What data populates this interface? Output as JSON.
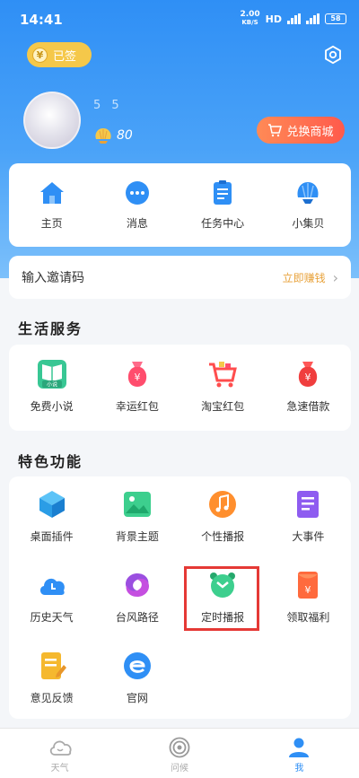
{
  "status_bar": {
    "time": "14:41",
    "net_speed_value": "2.00",
    "net_speed_unit": "KB/S",
    "hd": "HD",
    "battery": "58"
  },
  "header": {
    "signin_label": "已签",
    "coin_symbol": "¥",
    "username": "5 5",
    "shell_count": "80",
    "mall_label": "兑换商城"
  },
  "nav": [
    {
      "label": "主页",
      "icon": "home-icon"
    },
    {
      "label": "消息",
      "icon": "message-icon"
    },
    {
      "label": "任务中心",
      "icon": "task-icon"
    },
    {
      "label": "小集贝",
      "icon": "shell-icon"
    }
  ],
  "invite": {
    "label": "输入邀请码",
    "link": "立即赚钱"
  },
  "life": {
    "title": "生活服务",
    "items": [
      {
        "label": "免费小说",
        "icon": "book-icon",
        "badge": "小说"
      },
      {
        "label": "幸运红包",
        "icon": "lucky-bag-icon"
      },
      {
        "label": "淘宝红包",
        "icon": "shopping-cart-icon"
      },
      {
        "label": "急速借款",
        "icon": "money-bag-icon"
      }
    ]
  },
  "features": {
    "title": "特色功能",
    "items": [
      {
        "label": "桌面插件",
        "icon": "cube-icon"
      },
      {
        "label": "背景主题",
        "icon": "image-icon"
      },
      {
        "label": "个性播报",
        "icon": "music-icon"
      },
      {
        "label": "大事件",
        "icon": "document-icon"
      },
      {
        "label": "历史天气",
        "icon": "cloud-clock-icon"
      },
      {
        "label": "台风路径",
        "icon": "typhoon-icon"
      },
      {
        "label": "定时播报",
        "icon": "alarm-clock-icon"
      },
      {
        "label": "领取福利",
        "icon": "red-envelope-icon"
      },
      {
        "label": "意见反馈",
        "icon": "feedback-icon"
      },
      {
        "label": "官网",
        "icon": "website-icon"
      }
    ]
  },
  "tabs": [
    {
      "label": "天气",
      "icon": "weather-tab-icon",
      "active": false
    },
    {
      "label": "问候",
      "icon": "greeting-tab-icon",
      "active": false
    },
    {
      "label": "我",
      "icon": "profile-tab-icon",
      "active": true
    }
  ],
  "colors": {
    "primary": "#2f8ff5",
    "accent": "#e8a23a",
    "highlight": "#e53935"
  }
}
